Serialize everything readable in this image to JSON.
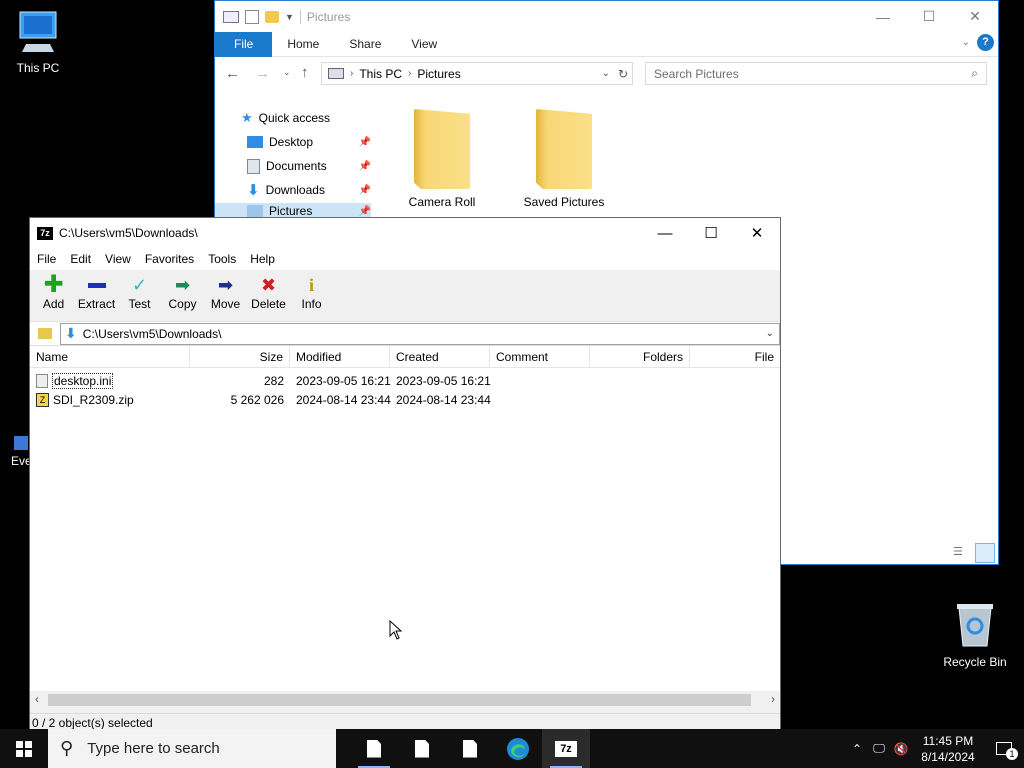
{
  "desktop": {
    "this_pc_label": "This PC",
    "recycle_bin_label": "Recycle Bin",
    "partial_icon_label": "Eve"
  },
  "explorer": {
    "title": "Pictures",
    "ribbon_tabs": [
      "File",
      "Home",
      "Share",
      "View"
    ],
    "breadcrumb": [
      "This PC",
      "Pictures"
    ],
    "search_placeholder": "Search Pictures",
    "nav": {
      "quick_access": "Quick access",
      "items": [
        "Desktop",
        "Documents",
        "Downloads",
        "Pictures"
      ]
    },
    "folders": [
      "Camera Roll",
      "Saved Pictures"
    ]
  },
  "zip": {
    "title": "C:\\Users\\vm5\\Downloads\\",
    "menu": [
      "File",
      "Edit",
      "View",
      "Favorites",
      "Tools",
      "Help"
    ],
    "toolbar": [
      "Add",
      "Extract",
      "Test",
      "Copy",
      "Move",
      "Delete",
      "Info"
    ],
    "path": "C:\\Users\\vm5\\Downloads\\",
    "columns": [
      "Name",
      "Size",
      "Modified",
      "Created",
      "Comment",
      "Folders",
      "File"
    ],
    "rows": [
      {
        "name": "desktop.ini",
        "size": "282",
        "modified": "2023-09-05 16:21",
        "created": "2023-09-05 16:21"
      },
      {
        "name": "SDI_R2309.zip",
        "size": "5 262 026",
        "modified": "2024-08-14 23:44",
        "created": "2024-08-14 23:44"
      }
    ],
    "status": "0 / 2 object(s) selected"
  },
  "taskbar": {
    "search_placeholder": "Type here to search",
    "time": "11:45 PM",
    "date": "8/14/2024",
    "notification_count": "1"
  },
  "colors": {
    "accent": "#1979ca",
    "taskbar": "#101010",
    "desktop": "#000000"
  }
}
